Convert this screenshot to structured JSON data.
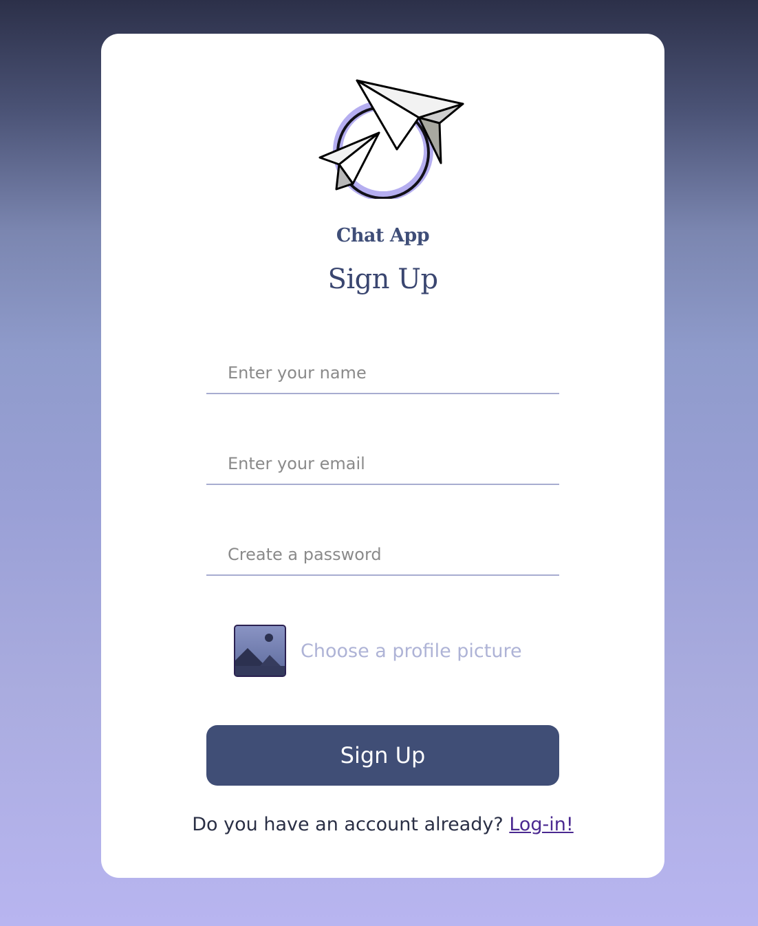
{
  "app": {
    "brand_name": "Chat App",
    "page_title": "Sign Up"
  },
  "form": {
    "name_placeholder": "Enter your name",
    "email_placeholder": "Enter your email",
    "password_placeholder": "Create a password",
    "picture_label": "Choose a profile picture",
    "submit_label": "Sign Up"
  },
  "footer": {
    "prompt": "Do you have an account already?",
    "link_label": "Log-in!"
  },
  "icons": {
    "logo": "paper-planes-logo-icon",
    "picture": "image-icon"
  },
  "colors": {
    "primary": "#404e76",
    "link": "#4a2890",
    "accent": "#b8b5f0"
  }
}
